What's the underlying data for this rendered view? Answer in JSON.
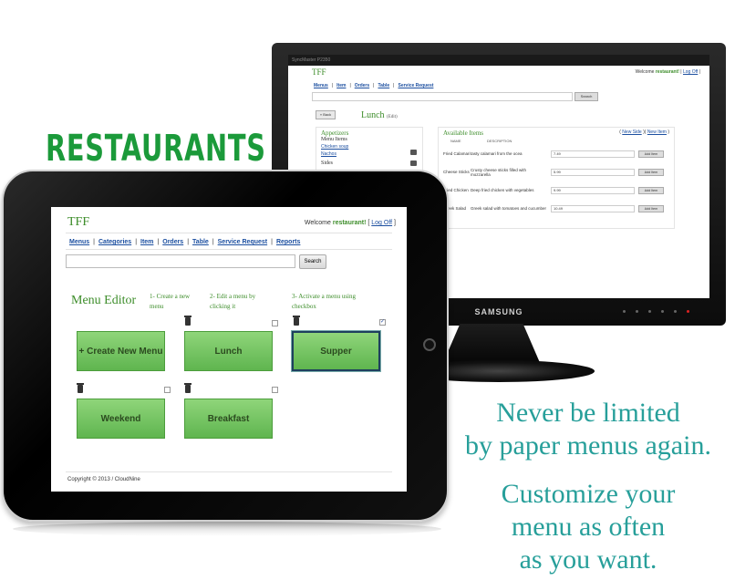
{
  "brand_title": "RESTAURANTS",
  "tagline1": [
    "Never be limited",
    "by paper menus again."
  ],
  "tagline2": [
    "Customize your",
    "menu as often",
    "as you want."
  ],
  "colors": {
    "accent_green": "#3d8d2a",
    "teal_text": "#279f9a",
    "link_blue": "#1c4fa0",
    "tile_green": "#6fc35f"
  },
  "monitor": {
    "brand": "SAMSUNG",
    "topbar": "SyncMaster P2350",
    "app": {
      "title": "TFF",
      "welcome_prefix": "Welcome ",
      "username": "restaurant!",
      "logoff_open": " | ",
      "logoff": "Log Off",
      "logoff_close": " |",
      "nav": [
        "Menus",
        "Item",
        "Orders",
        "Table",
        "Service Request"
      ],
      "search_button": "Search",
      "back_button": "« Back",
      "menu_name": "Lunch",
      "edit_link": "(Edit)",
      "left_panel": {
        "appetizers": "Appetizers",
        "menu_items": "Menu Items",
        "items": [
          "Chicken soup",
          "Nachos"
        ],
        "sides": "Sides"
      },
      "available": {
        "title": "Available Items",
        "new_side": "New Side",
        "new_item": "New Item",
        "col_name": "NAME",
        "col_desc": "DESCRIPTION",
        "add_button": "Add Item",
        "rows": [
          {
            "name": "Fried Calamari",
            "desc": "tasty calamari from the ocea",
            "price": "7.49"
          },
          {
            "name": "Cheese Sticks",
            "desc": "Crusty cheese sticks filled with mozzarella",
            "price": "5.99"
          },
          {
            "name": "Fried Chicken",
            "desc": "Deep fried chicken with vegetables",
            "price": "9.99"
          },
          {
            "name": "Greek Salad",
            "desc": "Greek salad with tomatoes and cucumber",
            "price": "10.49"
          }
        ]
      }
    }
  },
  "tablet": {
    "title": "TFF",
    "welcome_prefix": "Welcome ",
    "username": "restaurant!",
    "logoff_open": " [ ",
    "logoff": "Log Off",
    "logoff_close": " ]",
    "nav": [
      "Menus",
      "Categories",
      "Item",
      "Orders",
      "Table",
      "Service Request",
      "Reports"
    ],
    "search_button": "Search",
    "editor_title": "Menu Editor",
    "steps": [
      "1- Create a new menu",
      "2- Edit a menu by clicking it",
      "3- Activate a menu using checkbox"
    ],
    "tiles": [
      "+ Create New Menu",
      "Lunch",
      "Supper",
      "Weekend",
      "Breakfast"
    ],
    "active_checkbox_mark": "✓",
    "copyright": "Copyright © 2013 / CloudNine"
  }
}
